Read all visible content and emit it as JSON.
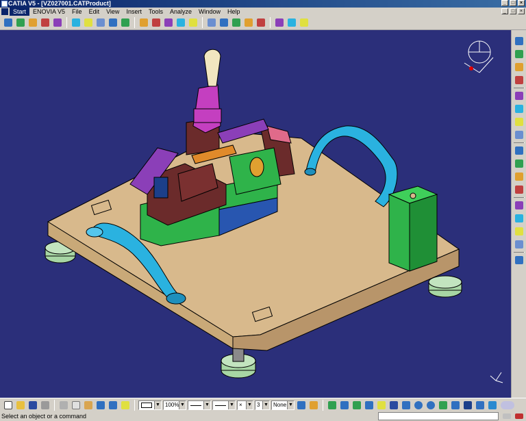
{
  "window": {
    "title": "CATIA V5 - [VZ027001.CATProduct]",
    "controls": [
      "_",
      "□",
      "×"
    ]
  },
  "menu": {
    "items": [
      "Start",
      "ENOVIA V5",
      "File",
      "Edit",
      "View",
      "Insert",
      "Tools",
      "Analyze",
      "Window",
      "Help"
    ]
  },
  "bottom_toolbar": {
    "zoom_value": "100%",
    "layer_value": "None",
    "thickness_value": "3",
    "point_value": "×"
  },
  "status": {
    "message": "Select an object or a command"
  },
  "colors": {
    "background": "#2b2f7a",
    "plate": "#d8b98c",
    "green": "#2fb34a",
    "cyan": "#2ab2e0",
    "purple": "#8b3fb8",
    "magenta": "#c43fc0",
    "maroon": "#6b2b2b",
    "feet": "#a7d6a4"
  },
  "icons": {
    "top": [
      "selection-arrow-icon",
      "product-icon",
      "assembly-icon",
      "constraint-icon",
      "move-icon",
      "snap-icon",
      "explode-icon",
      "clash-icon",
      "section-icon",
      "distance-icon",
      "manipulate-icon",
      "fix-icon",
      "fix-together-icon",
      "coincidence-icon",
      "contact-icon",
      "offset-icon",
      "angle-icon",
      "flexible-icon",
      "update-icon",
      "catalog-icon",
      "spin-icon",
      "measure-icon",
      "grid-icon"
    ],
    "right": [
      "compass-icon",
      "select-icon",
      "sketch-icon",
      "pad-icon",
      "pocket-icon",
      "shaft-icon",
      "hole-icon",
      "rib-icon",
      "fillet-icon",
      "chamfer-icon",
      "draft-icon",
      "shell-icon",
      "thickness-icon",
      "mirror-icon",
      "pattern-icon",
      "scale-icon",
      "publish-icon"
    ],
    "bottom": [
      "new-icon",
      "open-icon",
      "save-icon",
      "print-icon",
      "cut-icon",
      "copy-icon",
      "paste-icon",
      "undo-icon",
      "redo-icon",
      "what-is-this-icon",
      "fly-icon",
      "fit-all-icon",
      "pan-icon",
      "rotate-icon",
      "zoom-in-icon",
      "zoom-out-icon",
      "normal-view-icon",
      "iso-view-icon",
      "shading-icon",
      "hide-show-icon",
      "swap-icon",
      "catia-logo-icon"
    ]
  }
}
